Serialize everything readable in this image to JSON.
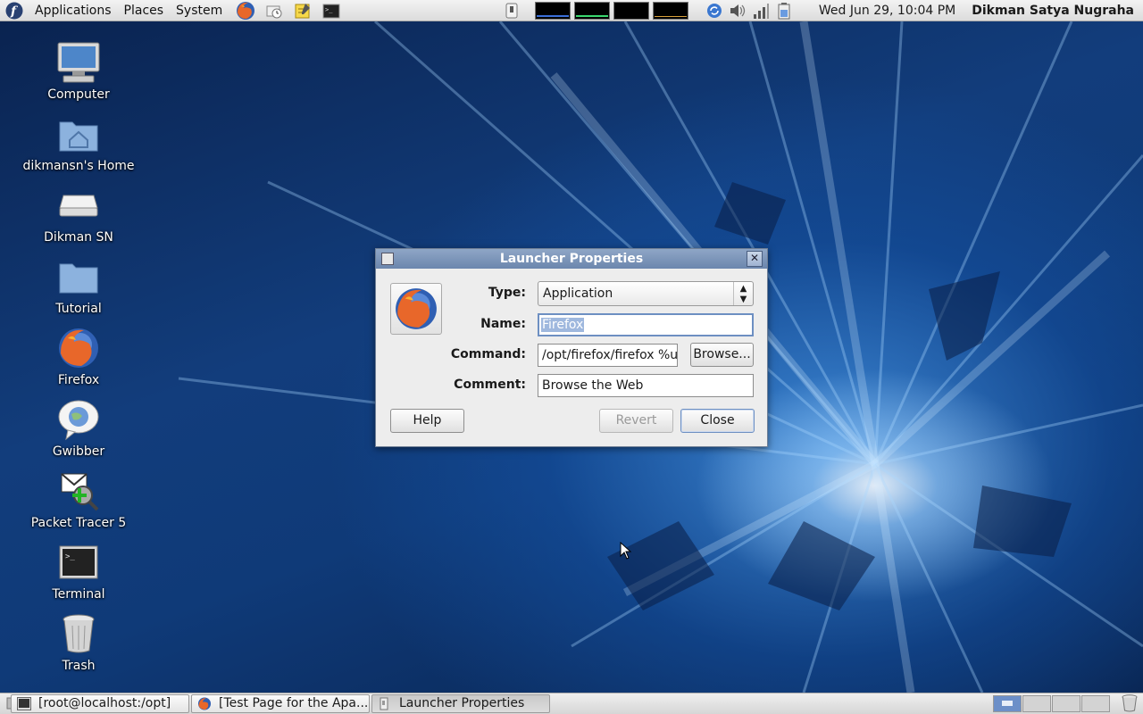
{
  "top_panel": {
    "menus": [
      "Applications",
      "Places",
      "System"
    ],
    "clock": "Wed Jun 29, 10:04 PM",
    "username": "Dikman Satya Nugraha"
  },
  "desktop": {
    "icons": [
      {
        "label": "Computer",
        "icon": "computer-icon"
      },
      {
        "label": "dikmansn's Home",
        "icon": "home-folder-icon"
      },
      {
        "label": "Dikman SN",
        "icon": "drive-icon"
      },
      {
        "label": "Tutorial",
        "icon": "folder-icon"
      },
      {
        "label": "Firefox",
        "icon": "firefox-icon"
      },
      {
        "label": "Gwibber",
        "icon": "gwibber-icon"
      },
      {
        "label": "Packet Tracer 5",
        "icon": "packet-tracer-icon"
      },
      {
        "label": "Terminal",
        "icon": "terminal-icon"
      },
      {
        "label": "Trash",
        "icon": "trash-icon"
      }
    ]
  },
  "dialog": {
    "title": "Launcher Properties",
    "type_label": "Type:",
    "type_value": "Application",
    "name_label": "Name:",
    "name_value": "Firefox",
    "command_label": "Command:",
    "command_value": "/opt/firefox/firefox %u",
    "comment_label": "Comment:",
    "comment_value": "Browse the Web",
    "browse_label": "Browse...",
    "help_label": "Help",
    "revert_label": "Revert",
    "close_label": "Close"
  },
  "taskbar": {
    "tasks": [
      {
        "label": "[root@localhost:/opt]",
        "icon": "terminal-icon"
      },
      {
        "label": "[Test Page for the Apa...",
        "icon": "firefox-icon"
      },
      {
        "label": "Launcher Properties",
        "icon": "window-icon"
      }
    ]
  },
  "colors": {
    "title_bar": "#7b93b8",
    "selection": "#9fb8de",
    "wallpaper": "#123d7c"
  }
}
